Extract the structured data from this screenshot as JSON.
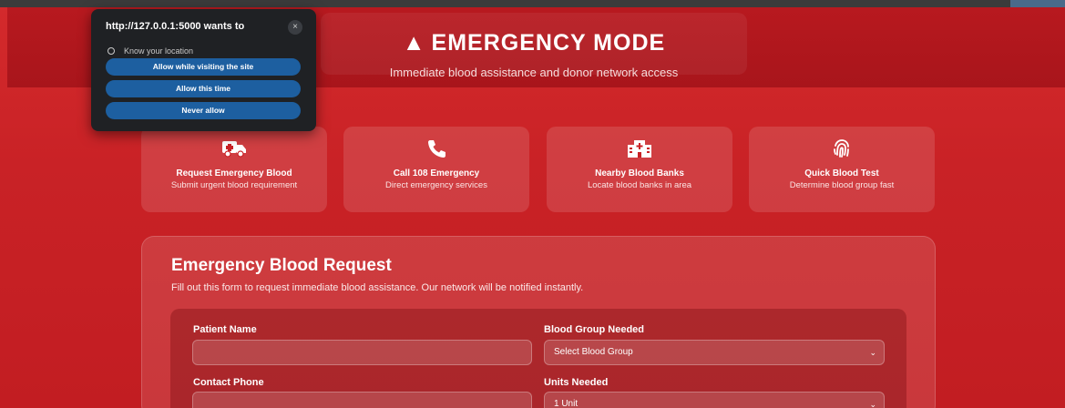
{
  "permission_popup": {
    "origin_text": "http://127.0.0.1:5000 wants to",
    "request": "Know your location",
    "buttons": [
      "Allow while visiting the site",
      "Allow this time",
      "Never allow"
    ],
    "close_glyph": "×"
  },
  "hero": {
    "warning_glyph": "▲",
    "title": "EMERGENCY MODE",
    "subtitle": "Immediate blood assistance and donor network access"
  },
  "quick_actions": [
    {
      "icon": "ambulance-icon",
      "title": "Request Emergency Blood",
      "description": "Submit urgent blood requirement"
    },
    {
      "icon": "phone-icon",
      "title": "Call 108 Emergency",
      "description": "Direct emergency services"
    },
    {
      "icon": "hospital-icon",
      "title": "Nearby Blood Banks",
      "description": "Locate blood banks in area"
    },
    {
      "icon": "fingerprint-icon",
      "title": "Quick Blood Test",
      "description": "Determine blood group fast"
    }
  ],
  "form": {
    "title": "Emergency Blood Request",
    "description": "Fill out this form to request immediate blood assistance. Our network will be notified instantly.",
    "fields": {
      "patient_name": {
        "label": "Patient Name",
        "value": ""
      },
      "blood_group": {
        "label": "Blood Group Needed",
        "value": "Select Blood Group"
      },
      "contact_phone": {
        "label": "Contact Phone",
        "value": ""
      },
      "units": {
        "label": "Units Needed",
        "value": "1 Unit"
      }
    }
  },
  "colors": {
    "background": "#c92226",
    "header": "#b8191f",
    "popup": "#1f2124",
    "popup_button": "#1d5fa0"
  }
}
